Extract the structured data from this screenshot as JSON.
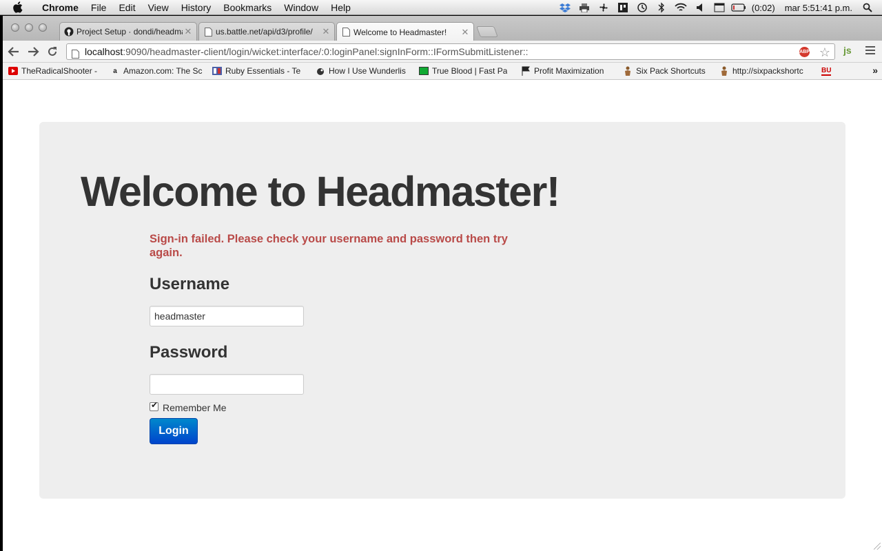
{
  "menubar": {
    "app": "Chrome",
    "items": [
      "File",
      "Edit",
      "View",
      "History",
      "Bookmarks",
      "Window",
      "Help"
    ],
    "battery": "(0:02)",
    "clock": "mar 5:51:41 p.m."
  },
  "tabs": [
    {
      "title": "Project Setup · dondi/headmaster",
      "icon": "github-icon"
    },
    {
      "title": "us.battle.net/api/d3/profile/",
      "icon": "page-icon"
    },
    {
      "title": "Welcome to Headmaster!",
      "icon": "page-icon",
      "active": true
    }
  ],
  "address": {
    "host": "localhost",
    "rest": ":9090/headmaster-client/login/wicket:interface/:0:loginPanel:signInForm::IFormSubmitListener::"
  },
  "extensions": {
    "abp": "ABP",
    "js": "js"
  },
  "bookmarks": [
    {
      "label": "TheRadicalShooter -",
      "icon": "youtube-icon"
    },
    {
      "label": "Amazon.com: The Sc",
      "icon": "amazon-icon"
    },
    {
      "label": "Ruby Essentials - Te",
      "icon": "ruby-icon"
    },
    {
      "label": "How I Use Wunderlis",
      "icon": "bird-icon"
    },
    {
      "label": "True Blood | Fast Pa",
      "icon": "tv-icon"
    },
    {
      "label": "Profit Maximization",
      "icon": "flag-icon"
    },
    {
      "label": "Six Pack Shortcuts",
      "icon": "man-icon"
    },
    {
      "label": "http://sixpackshortc",
      "icon": "man-icon"
    },
    {
      "label": "BU",
      "icon": "bu-icon"
    }
  ],
  "page": {
    "heading": "Welcome to Headmaster!",
    "error": "Sign-in failed. Please check your username and password then try again.",
    "username_label": "Username",
    "username_value": "headmaster",
    "password_label": "Password",
    "password_value": "",
    "remember_label": "Remember Me",
    "remember_checked": true,
    "login_label": "Login"
  },
  "colors": {
    "error": "#b94a48",
    "button_top": "#0088cc",
    "button_bottom": "#0044cc",
    "hero_bg": "#eeeeee"
  }
}
